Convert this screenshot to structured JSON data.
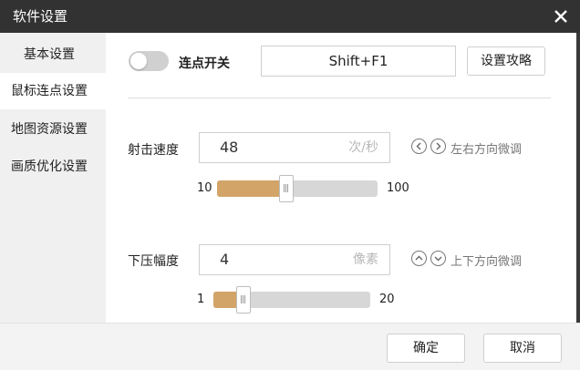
{
  "window": {
    "title": "软件设置"
  },
  "sidebar": {
    "items": [
      {
        "label": "基本设置",
        "active": false
      },
      {
        "label": "鼠标连点设置",
        "active": true
      },
      {
        "label": "地图资源设置",
        "active": false
      },
      {
        "label": "画质优化设置",
        "active": false
      }
    ]
  },
  "click_switch": {
    "label": "连点开关",
    "enabled": false,
    "hotkey": "Shift+F1"
  },
  "guide_button": {
    "label": "设置攻略"
  },
  "fire_speed": {
    "label": "射击速度",
    "value": "48",
    "unit": "次/秒",
    "hint": "左右方向微调",
    "min": "10",
    "max": "100",
    "slider_value": 48,
    "min_value": 10,
    "max_value": 100
  },
  "recoil": {
    "label": "下压幅度",
    "value": "4",
    "unit": "像素",
    "hint": "上下方向微调",
    "min": "1",
    "max": "20",
    "slider_value": 4,
    "min_value": 1,
    "max_value": 20
  },
  "footer": {
    "ok_label": "确定",
    "cancel_label": "取消"
  },
  "colors": {
    "titlebar": "#323232",
    "accent": "#d2a468",
    "sidebar": "#f0f0f0"
  },
  "icons": {
    "close": "close-icon",
    "left": "chevron-left-icon",
    "right": "chevron-right-icon",
    "up": "chevron-up-icon",
    "down": "chevron-down-icon"
  }
}
